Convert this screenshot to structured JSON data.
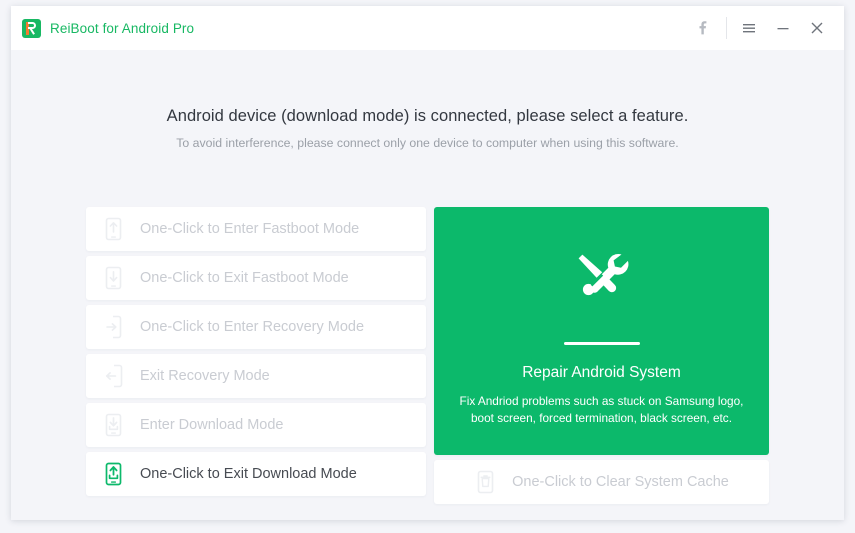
{
  "window": {
    "brand_title": "ReiBoot for Android Pro",
    "logo_icon": "reiboot-logo-icon",
    "controls": [
      {
        "name": "facebook-button",
        "icon": "facebook-icon",
        "label": "f"
      },
      {
        "name": "menu-button",
        "icon": "hamburger-menu-icon",
        "label": "≡"
      },
      {
        "name": "minimize-button",
        "icon": "minimize-icon",
        "label": "−"
      },
      {
        "name": "close-button",
        "icon": "close-icon",
        "label": "✕"
      }
    ]
  },
  "main": {
    "headline": "Android device (download mode) is connected, please select a feature.",
    "subline": "To avoid interference, please connect only one device to computer when using this software.",
    "mode_buttons": [
      {
        "label": "One-Click to Enter Fastboot Mode",
        "icon": "phone-up-arrow-icon",
        "enabled": false
      },
      {
        "label": "One-Click to Exit Fastboot Mode",
        "icon": "phone-down-arrow-icon",
        "enabled": false
      },
      {
        "label": "One-Click to Enter Recovery Mode",
        "icon": "phone-enter-arrow-icon",
        "enabled": false
      },
      {
        "label": "Exit Recovery Mode",
        "icon": "phone-exit-arrow-icon",
        "enabled": false
      },
      {
        "label": "Enter Download Mode",
        "icon": "phone-download-icon",
        "enabled": false
      },
      {
        "label": "One-Click to Exit Download Mode",
        "icon": "phone-upload-green-icon",
        "enabled": true
      }
    ],
    "hero": {
      "icon": "screwdriver-wrench-icon",
      "title": "Repair Android System",
      "description": "Fix Andriod problems such as stuck on Samsung logo, boot screen, forced termination, black screen, etc.",
      "background_color": "#0cb96b"
    },
    "cache_button": {
      "label": "One-Click to Clear System Cache",
      "icon": "trash-can-icon",
      "enabled": false
    }
  },
  "colors": {
    "brand_green": "#18b863",
    "hero_green": "#0cb96b",
    "disabled_text": "#c9ccd2",
    "active_text": "#474b52",
    "page_background": "#f4f5f9"
  }
}
